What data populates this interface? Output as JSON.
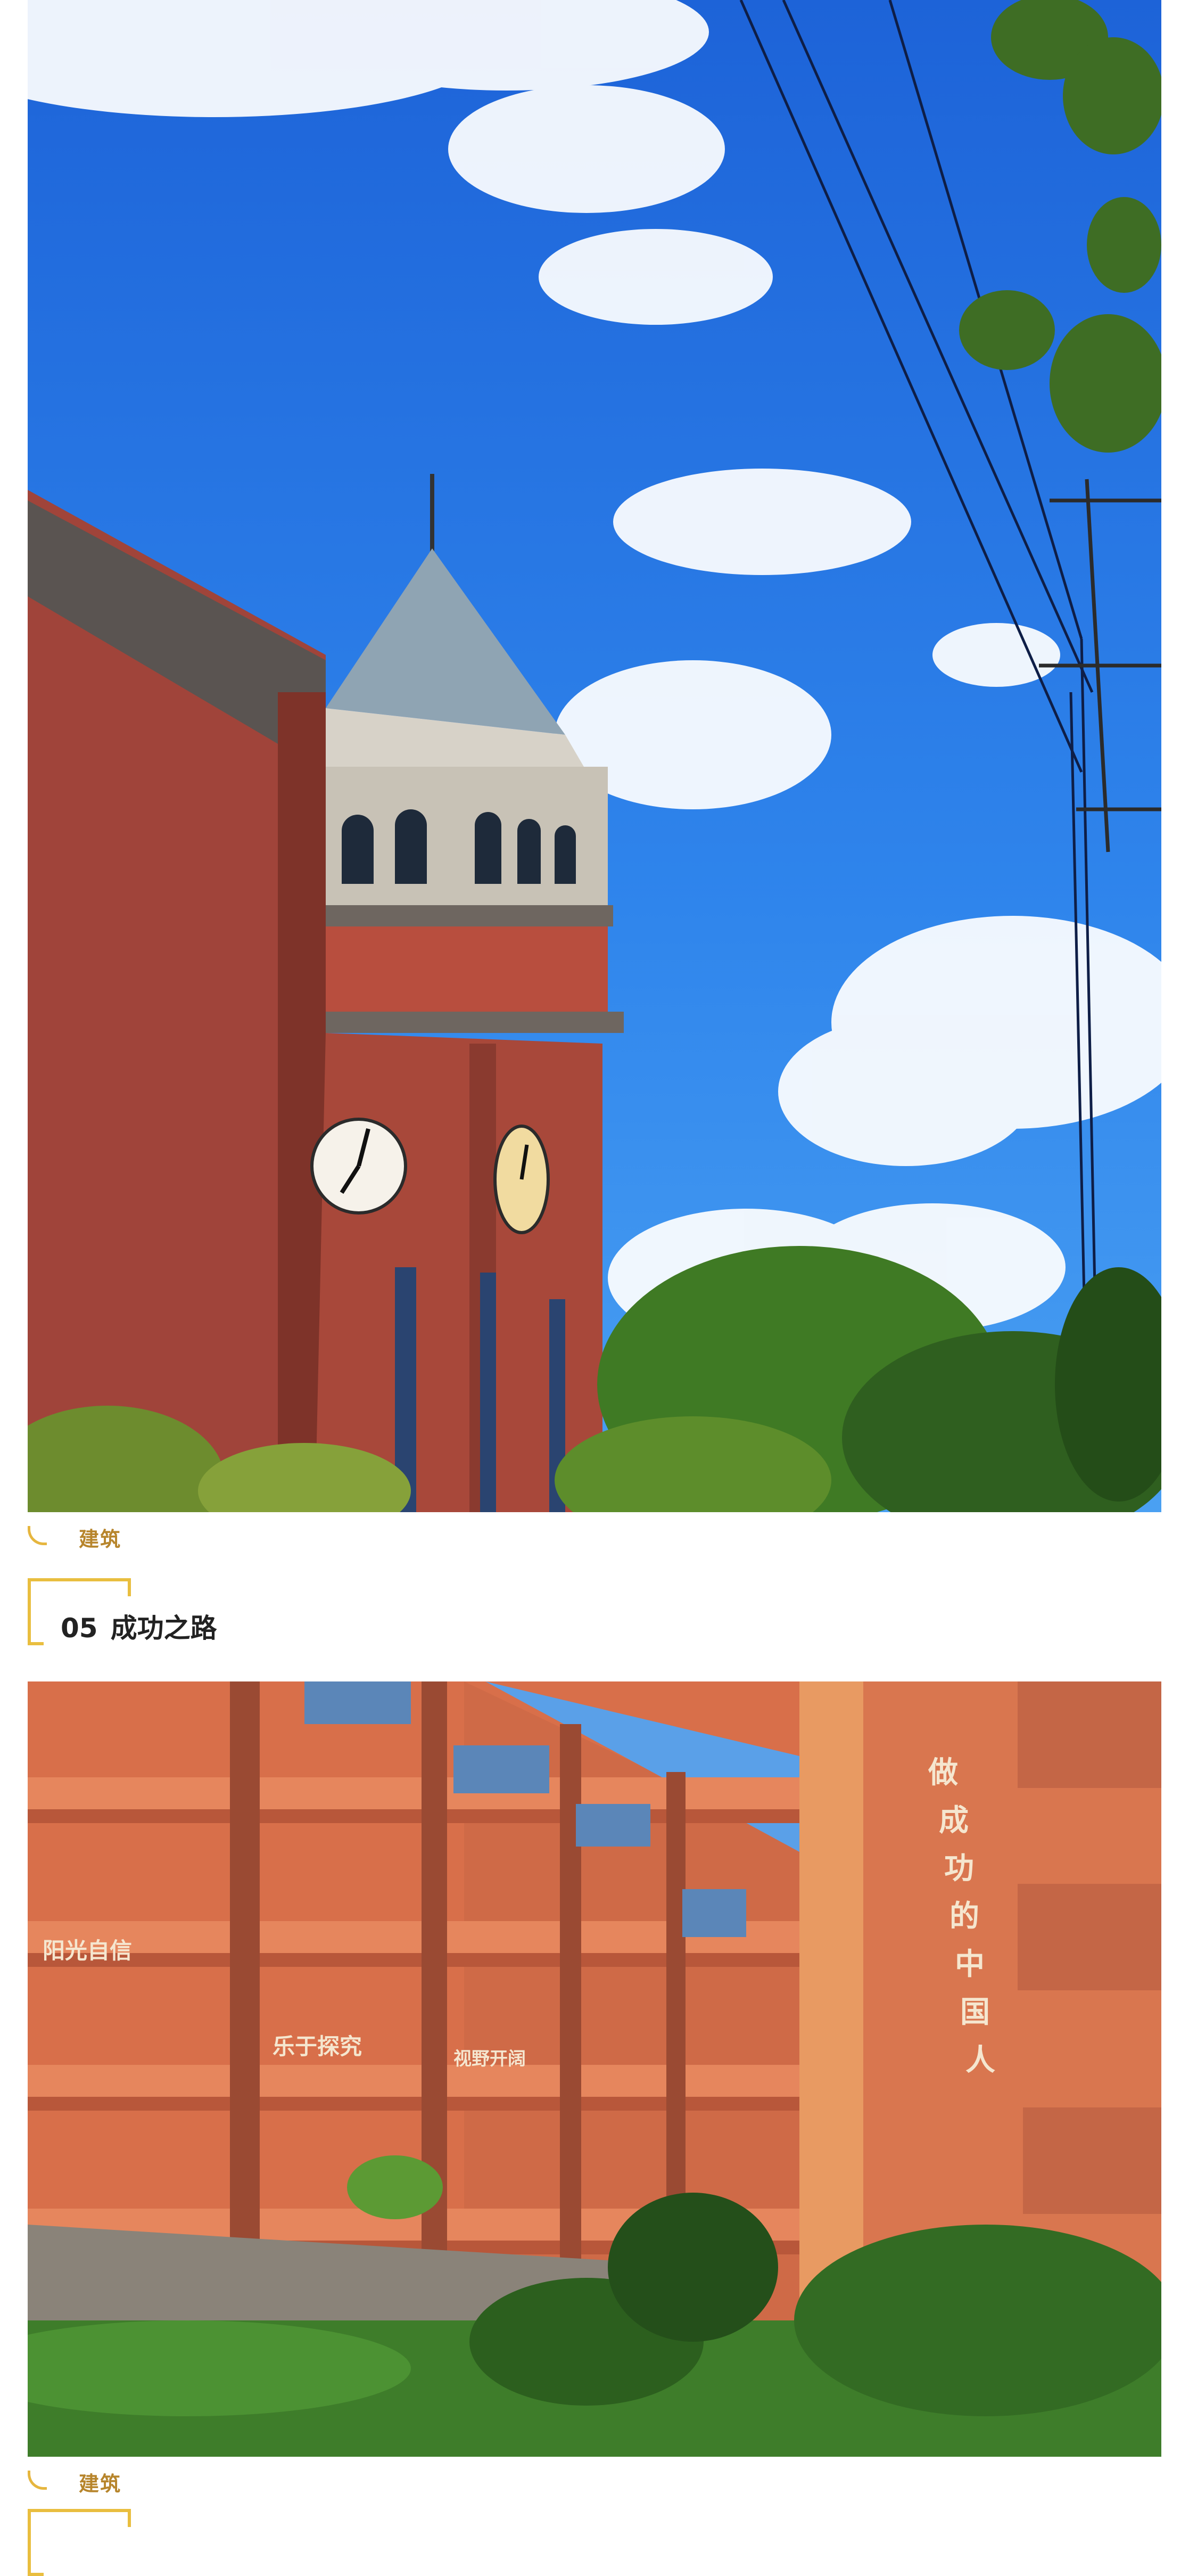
{
  "photos": [
    {
      "subject": "red brick clock tower under blue sky with clouds"
    },
    {
      "subject": "orange-red school building with slogan",
      "sign_texts": [
        "阳光自信",
        "乐于探究",
        "视野开阔",
        "做成功的中国人"
      ]
    }
  ],
  "captions": [
    {
      "label": "建筑"
    },
    {
      "label": "建筑"
    }
  ],
  "sections": [
    {
      "number": "05",
      "title": "成功之路"
    }
  ],
  "colors": {
    "accent": "#e9be3f",
    "caption_text": "#b7852c",
    "sky": "#2f7de6",
    "brick": "#a8483a"
  }
}
